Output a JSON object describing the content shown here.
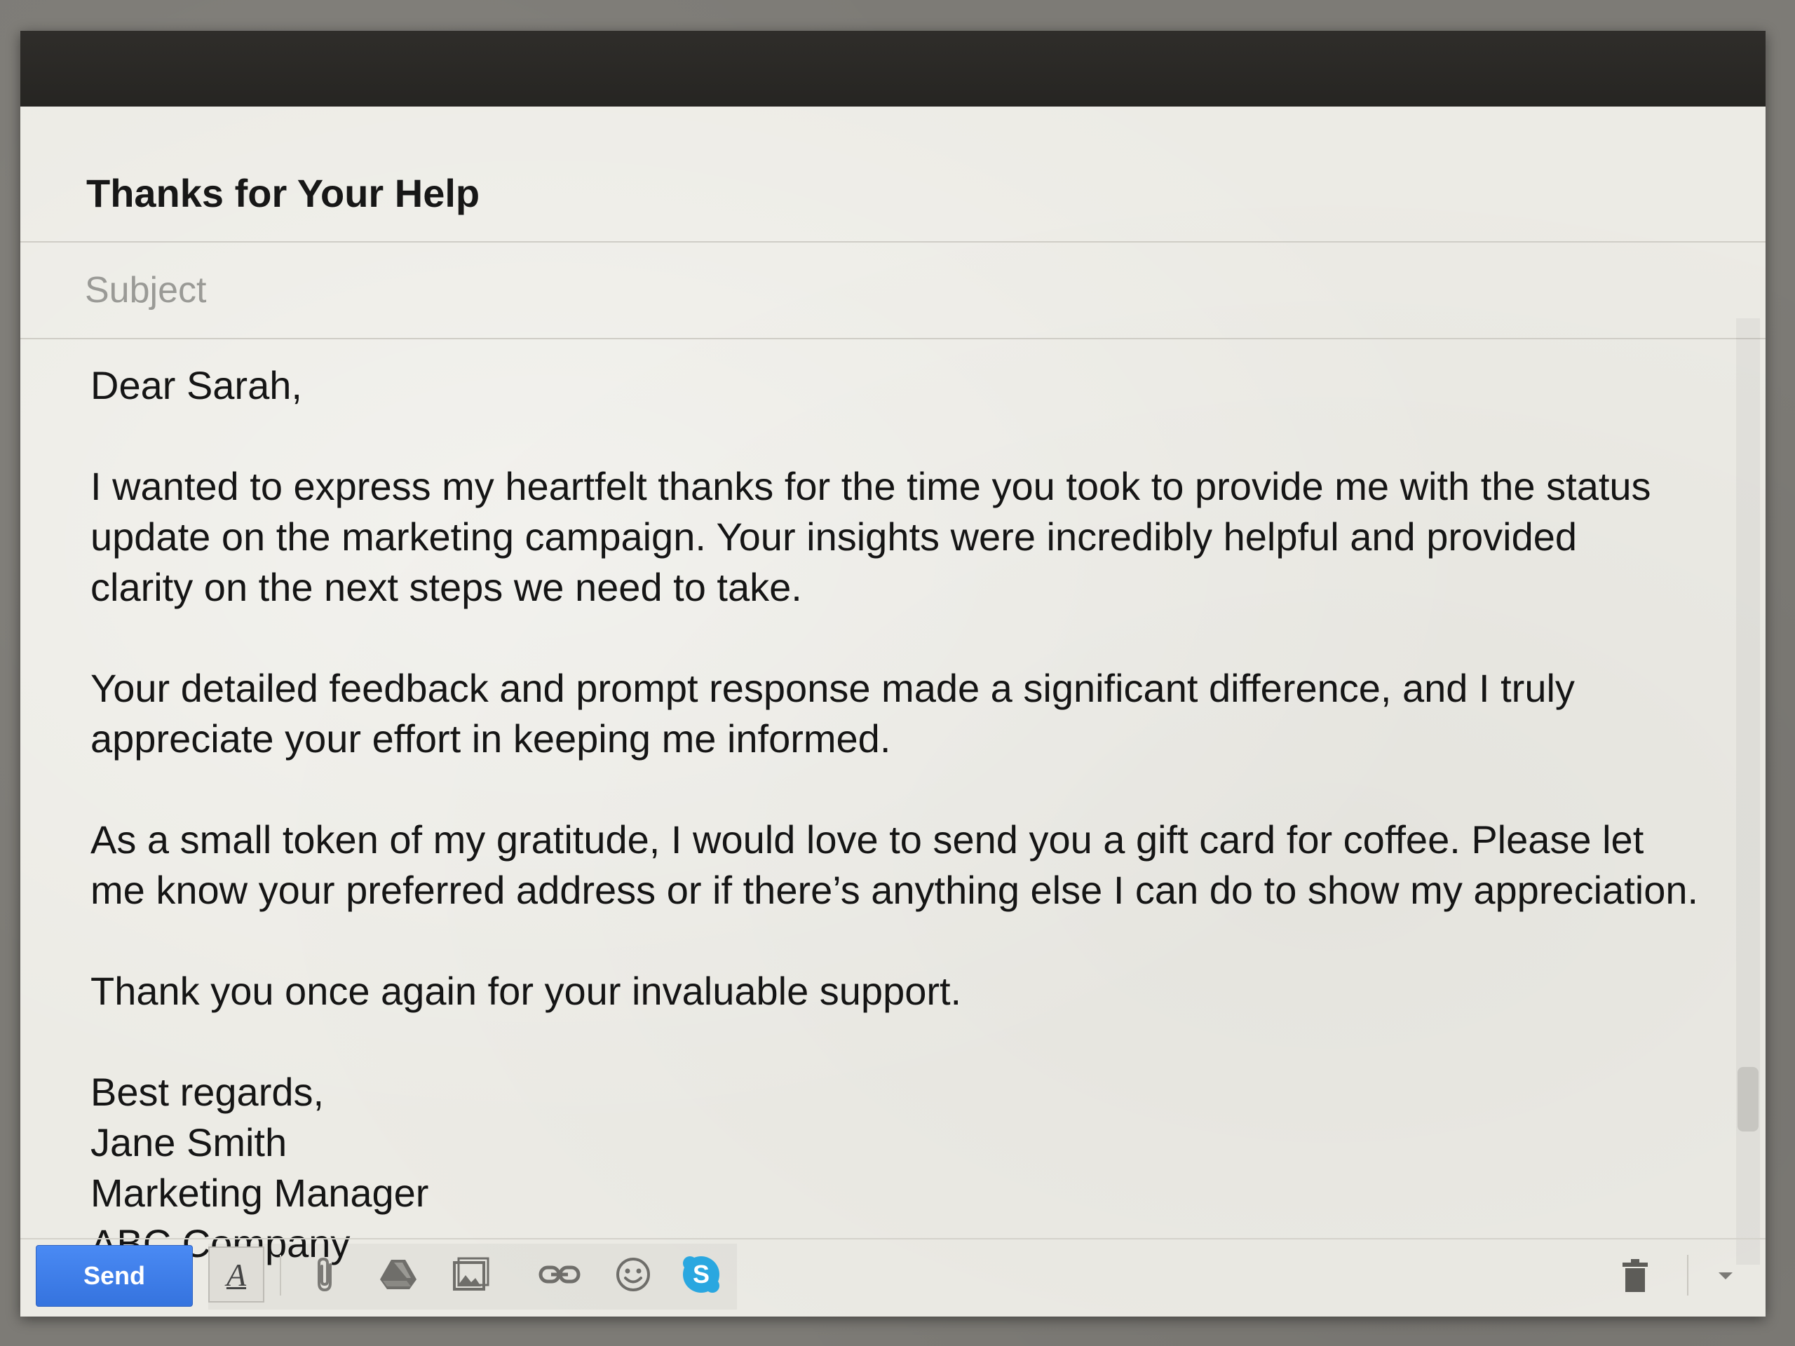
{
  "compose": {
    "to_field": "Thanks for Your Help",
    "subject_placeholder": "Subject",
    "subject_value": "",
    "body": {
      "greeting": "Dear Sarah,",
      "paragraph1_lines": [
        "I wanted to express my heartfelt thanks for the time you took to provide me with the status",
        "update on the marketing campaign. Your insights were incredibly helpful and provided",
        "clarity on the next steps we need to take."
      ],
      "paragraph2_lines": [
        "Your detailed feedback and prompt response made a significant difference, and I truly",
        "appreciate your effort in keeping me informed."
      ],
      "paragraph3_lines": [
        "As a small token of my gratitude, I would love to send you a gift card for coffee. Please let",
        "me know your preferred address or if there’s anything else I can do to show my appreciation."
      ],
      "closing_line": "Thank you once again for your invaluable support.",
      "signoff_lines": [
        "Best regards,",
        "Jane Smith",
        "Marketing Manager",
        "ABC Company"
      ]
    }
  },
  "toolbar": {
    "send_label": "Send",
    "format_label": "A",
    "icons": [
      "formatting-icon",
      "attach-icon",
      "drive-icon",
      "photo-icon",
      "link-icon",
      "emoji-icon",
      "skype-icon",
      "trash-icon",
      "more-options-icon"
    ]
  },
  "colors": {
    "send_button": "#3d7ee8",
    "skype": "#2aa7e0",
    "titlebar": "#2b2a27",
    "paper": "#ecebe5"
  }
}
